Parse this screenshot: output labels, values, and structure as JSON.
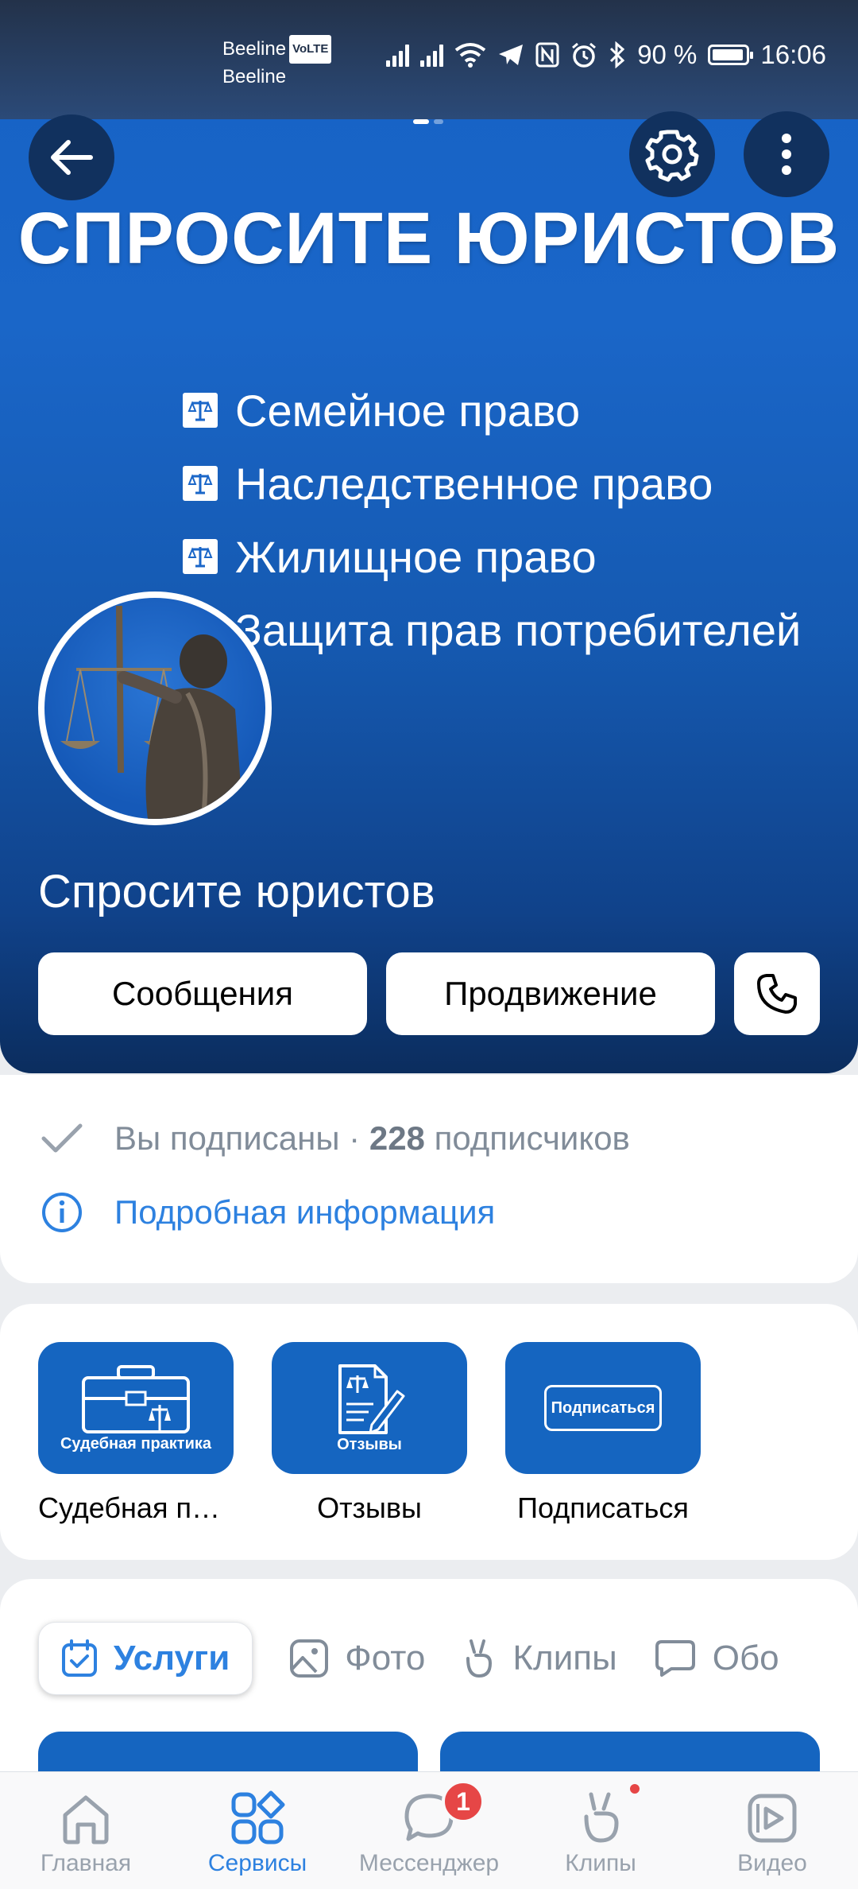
{
  "status_bar": {
    "carrier1": "Beeline",
    "carrier2": "Beeline",
    "volte": "VoLTE",
    "battery": "90 %",
    "time": "16:06"
  },
  "cover": {
    "title": "СПРОСИТЕ ЮРИСТОВ",
    "items": [
      "Семейное право",
      "Наследственное право",
      "Жилищное право",
      "Защита прав потребителей"
    ]
  },
  "group": {
    "name": "Спросите юристов",
    "actions": {
      "messages": "Сообщения",
      "promotion": "Продвижение"
    }
  },
  "info": {
    "subscribed": "Вы подписаны",
    "separator": "·",
    "followers_count": "228",
    "followers_label": "подписчиков",
    "details": "Подробная информация"
  },
  "apps": [
    {
      "tile_text": "Судебная практика",
      "label": "Судебная пра…"
    },
    {
      "tile_text": "Отзывы",
      "label": "Отзывы"
    },
    {
      "tile_text": "Подписаться",
      "label": "Подписаться"
    }
  ],
  "tabs": [
    {
      "label": "Услуги"
    },
    {
      "label": "Фото"
    },
    {
      "label": "Клипы"
    },
    {
      "label": "Обо"
    }
  ],
  "bottom_nav": [
    {
      "label": "Главная"
    },
    {
      "label": "Сервисы"
    },
    {
      "label": "Мессенджер",
      "badge": "1"
    },
    {
      "label": "Клипы"
    },
    {
      "label": "Видео"
    }
  ],
  "colors": {
    "accent": "#2d81e0",
    "tile": "#1565c0",
    "badge": "#e64646"
  }
}
